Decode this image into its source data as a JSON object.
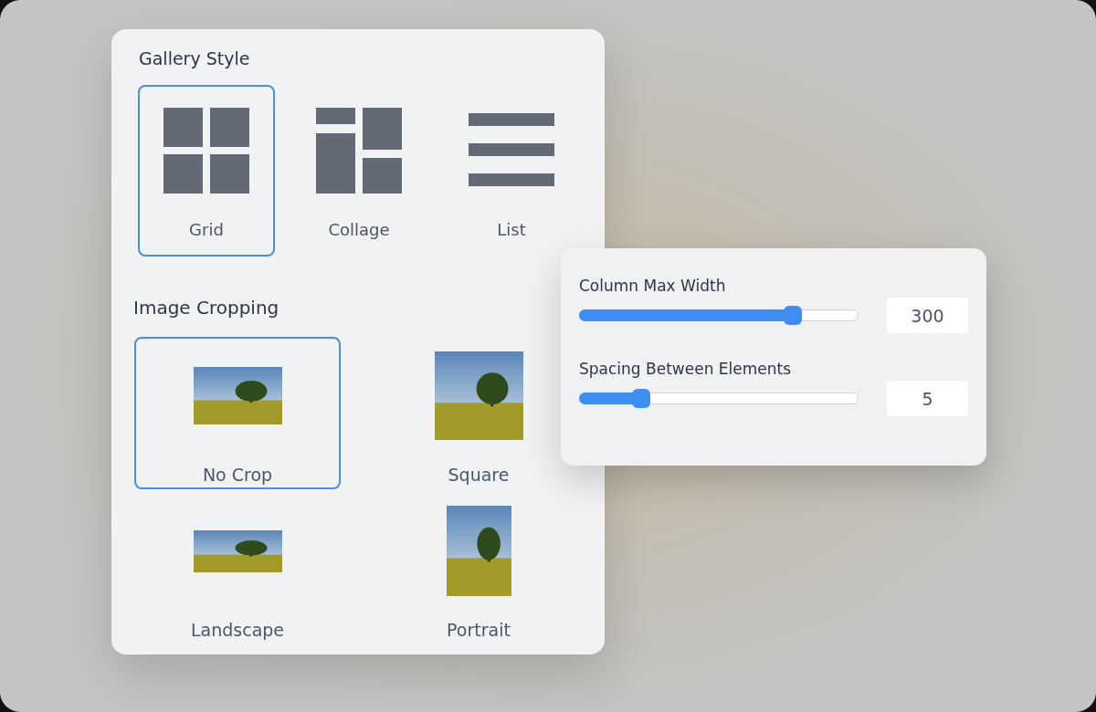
{
  "gallery_style": {
    "title": "Gallery Style",
    "options": [
      {
        "label": "Grid",
        "kind": "grid",
        "selected": true
      },
      {
        "label": "Collage",
        "kind": "collage",
        "selected": false
      },
      {
        "label": "List",
        "kind": "list",
        "selected": false
      }
    ]
  },
  "image_cropping": {
    "title": "Image Cropping",
    "options": [
      {
        "label": "No Crop",
        "kind": "nocrop",
        "selected": true
      },
      {
        "label": "Square",
        "kind": "square",
        "selected": false
      },
      {
        "label": "Landscape",
        "kind": "landscape",
        "selected": false
      },
      {
        "label": "Portrait",
        "kind": "portrait",
        "selected": false
      }
    ]
  },
  "settings": [
    {
      "label": "Column Max Width",
      "level": 0.76,
      "value": "300"
    },
    {
      "label": "Spacing Between Elements",
      "level": 0.22,
      "value": "5"
    }
  ]
}
